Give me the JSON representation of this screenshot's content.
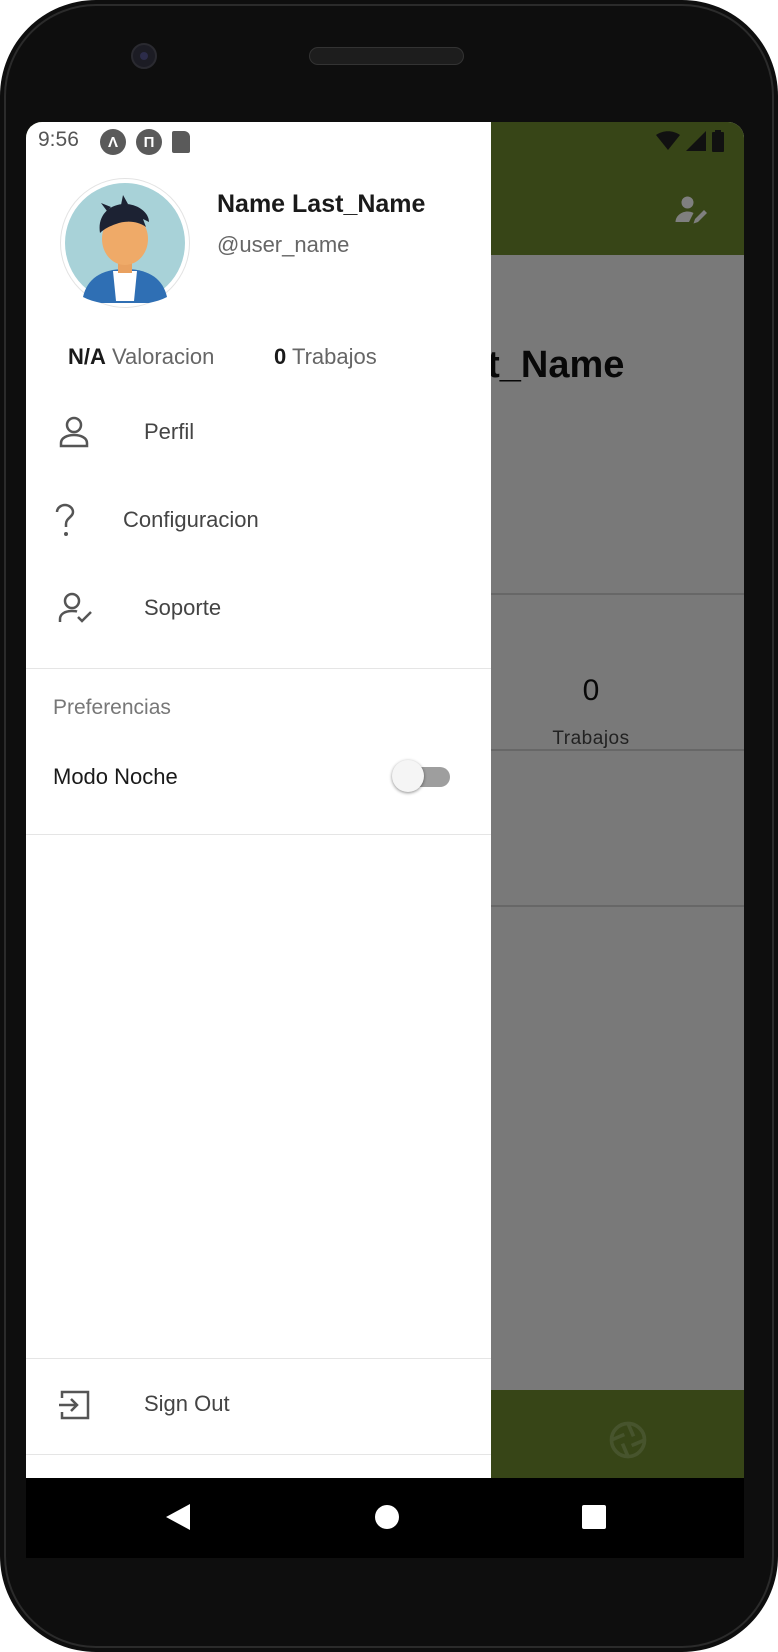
{
  "status_bar": {
    "time": "9:56",
    "left_icons": [
      "android-auto-icon",
      "notification-app-icon",
      "sd-card-icon"
    ],
    "right_icons": [
      "wifi-icon",
      "cell-signal-icon",
      "battery-icon"
    ]
  },
  "background_screen": {
    "appbar_color": "#6e8a2e",
    "edit_profile_icon": "edit-person-icon",
    "name_fragment": "st_Name",
    "stat_value": "0",
    "stat_label": "Trabajos",
    "bottom_icon": "camera-aperture-icon"
  },
  "drawer": {
    "avatar": "user-avatar-illustration",
    "name": "Name Last_Name",
    "handle": "@user_name",
    "rating_value": "N/A",
    "rating_label": "Valoracion",
    "jobs_value": "0",
    "jobs_label": "Trabajos",
    "menu": [
      {
        "label": "Perfil",
        "icon": "person-icon"
      },
      {
        "label": "Configuracion",
        "icon": "help-question-icon"
      },
      {
        "label": "Soporte",
        "icon": "person-check-icon"
      }
    ],
    "preferences_title": "Preferencias",
    "night_mode_label": "Modo Noche",
    "night_mode_enabled": false,
    "sign_out_label": "Sign Out",
    "sign_out_icon": "exit-icon"
  },
  "nav_bar": {
    "buttons": [
      "back-icon",
      "home-icon",
      "recents-icon"
    ]
  }
}
